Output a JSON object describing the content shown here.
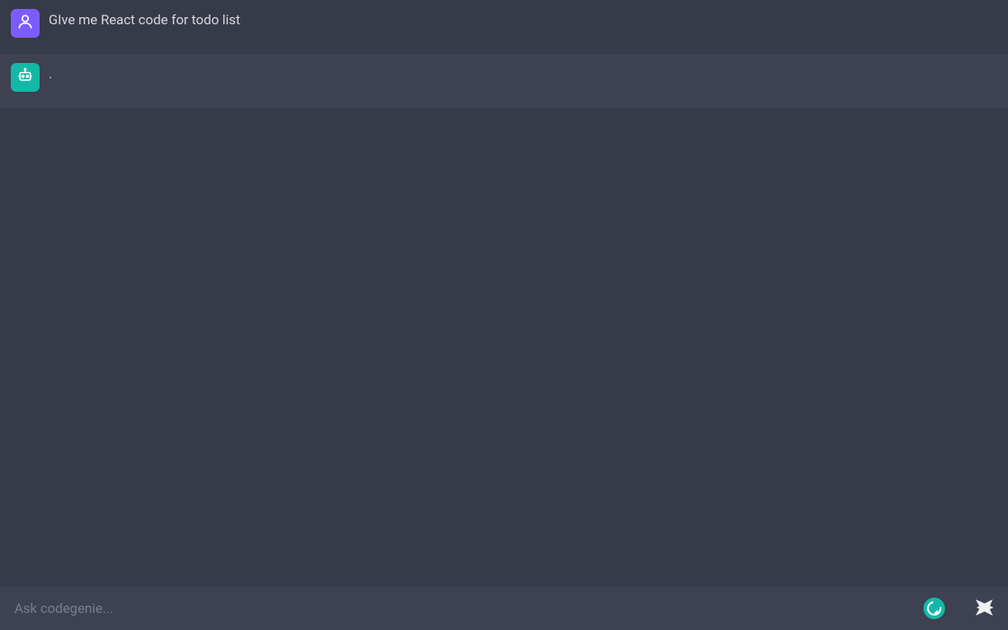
{
  "messages": {
    "user": {
      "text": "GIve me React code for todo list"
    },
    "bot": {
      "text": "."
    }
  },
  "input": {
    "placeholder": "Ask codegenie...",
    "value": ""
  },
  "icons": {
    "user": "person-icon",
    "bot": "robot-icon",
    "grammarly": "grammarly-icon",
    "send": "send-icon"
  }
}
